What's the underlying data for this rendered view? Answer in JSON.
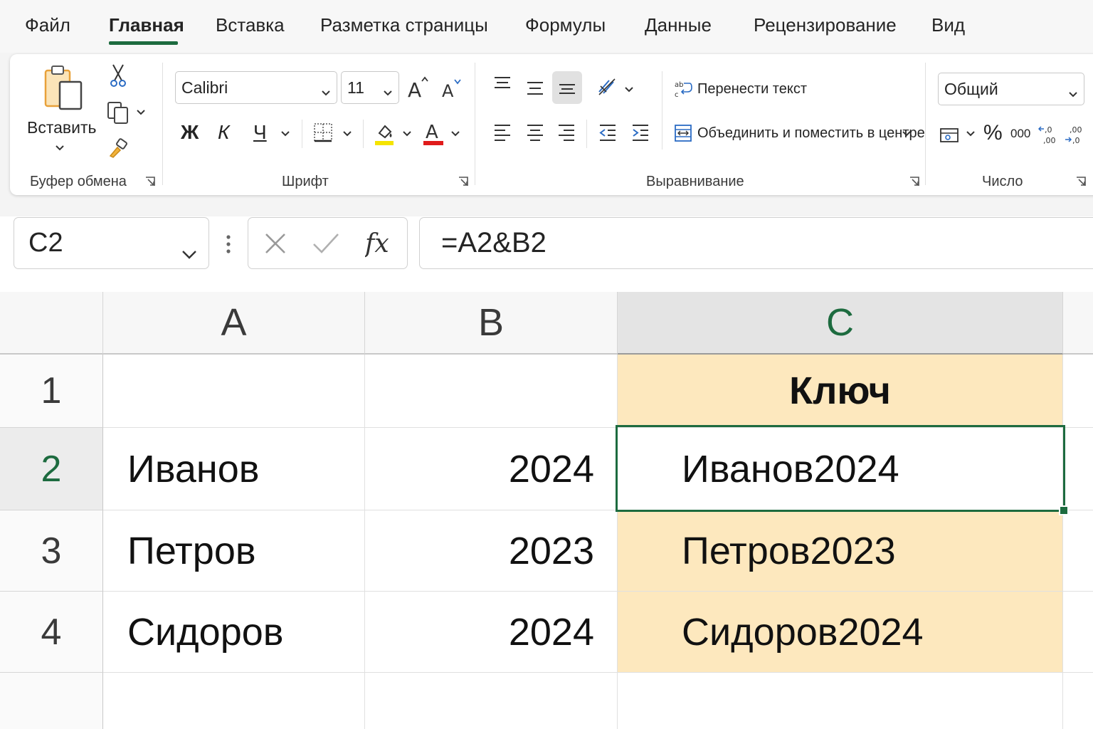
{
  "menu": {
    "tabs": [
      "Файл",
      "Главная",
      "Вставка",
      "Разметка страницы",
      "Формулы",
      "Данные",
      "Рецензирование",
      "Вид"
    ],
    "active_tab": "Главная"
  },
  "ribbon": {
    "clipboard": {
      "paste_label": "Вставить",
      "group_label": "Буфер обмена",
      "icons": [
        "clipboard-paste-icon",
        "scissors-icon",
        "copy-icon",
        "format-painter-icon"
      ]
    },
    "font": {
      "font_name": "Calibri",
      "font_size": "11",
      "bold": "Ж",
      "italic": "К",
      "underline": "Ч",
      "font_color_letter": "A",
      "group_label": "Шрифт",
      "highlight_color": "#f5e400",
      "font_color": "#e01b1b"
    },
    "alignment": {
      "wrap_text": "Перенести текст",
      "merge_center": "Объединить и поместить в центре",
      "group_label": "Выравнивание"
    },
    "number": {
      "format": "Общий",
      "percent": "%",
      "thousands": "000",
      "group_label": "Число"
    }
  },
  "formula_bar": {
    "name_box": "C2",
    "fx": "fx",
    "formula": "=A2&B2"
  },
  "sheet": {
    "columns": [
      "A",
      "B",
      "C"
    ],
    "rows": [
      "1",
      "2",
      "3",
      "4"
    ],
    "cells": {
      "A1": "",
      "B1": "",
      "C1": "Ключ",
      "A2": "Иванов",
      "B2": "2024",
      "C2": "Иванов2024",
      "A3": "Петров",
      "B3": "2023",
      "C3": "Петров2023",
      "A4": "Сидоров",
      "B4": "2024",
      "C4": "Сидоров2024"
    },
    "selected_cell": "C2",
    "accent_color": "#1d6b3f",
    "key_fill_color": "#fde8be"
  }
}
